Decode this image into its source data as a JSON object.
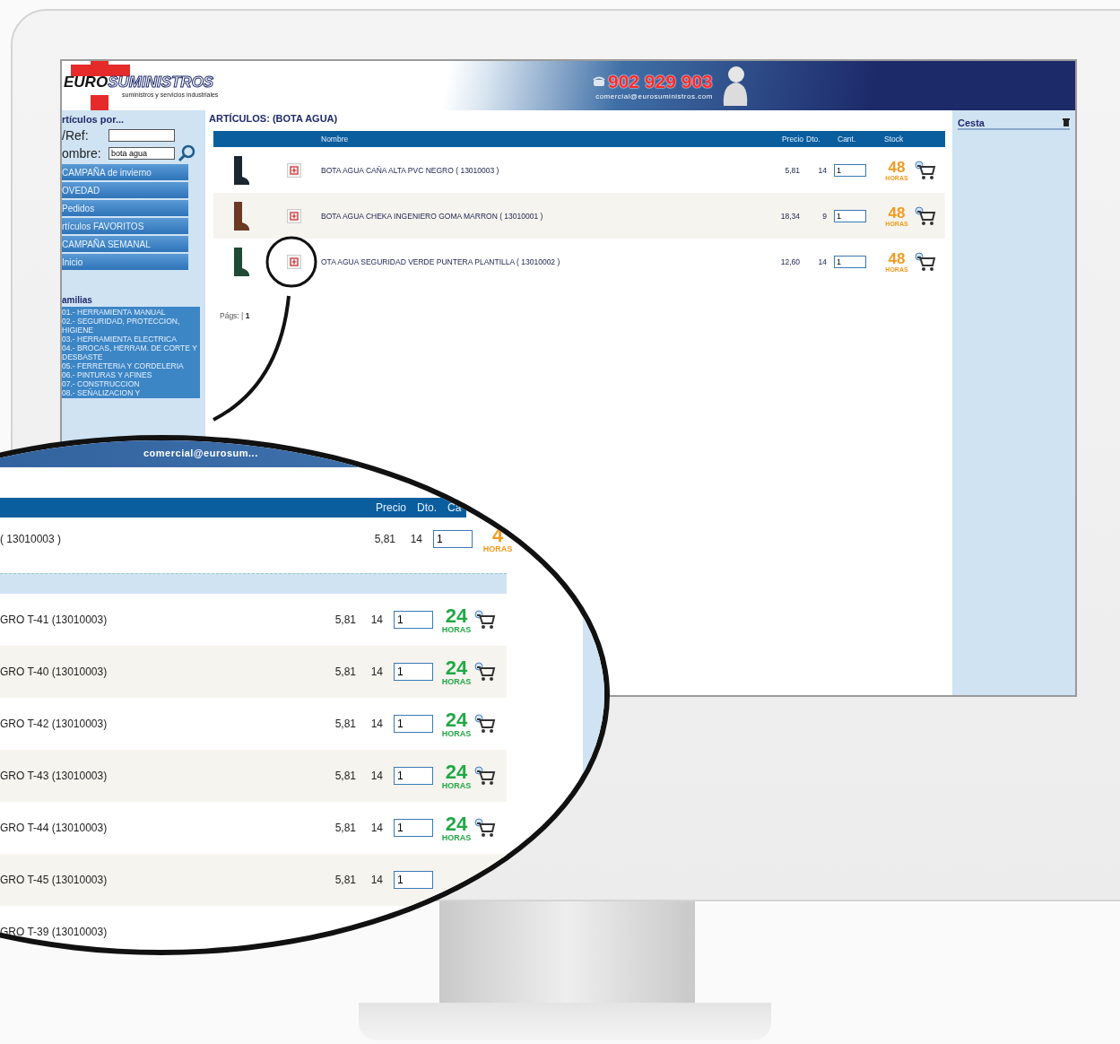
{
  "header": {
    "logo_bold": "EURO",
    "logo_rest": "SUMINISTROS",
    "tagline": "suministros y servicios industriales",
    "phone": "902 929 903",
    "email": "comercial@eurosuministros.com"
  },
  "sidebar": {
    "title": "rtículos por...",
    "ref_label": "/Ref:",
    "name_label": "ombre:",
    "name_value": "bota agua",
    "menu": [
      "CAMPAÑA de invierno",
      "OVEDAD",
      "Pedidos",
      "rtículos FAVORITOS",
      "CAMPAÑA SEMANAL",
      "Inicio"
    ],
    "families_title": "amilias",
    "families": [
      "01.- HERRAMIENTA MANUAL",
      "02.- SEGURIDAD, PROTECCION, HIGIENE",
      "03.- HERRAMIENTA ELECTRICA",
      "04.- BROCAS, HERRAM. DE CORTE Y DESBASTE",
      "05.- FERRETERIA Y CORDELERIA",
      "06.- PINTURAS Y AFINES",
      "07.- CONSTRUCCION",
      "08.- SEÑALIZACION Y"
    ]
  },
  "main": {
    "title": "ARTÍCULOS: (BOTA AGUA)",
    "columns": [
      "Nombre",
      "Precio",
      "Dto.",
      "Cant.",
      "Stock"
    ],
    "rows": [
      {
        "color": "#1a2630",
        "name": "BOTA AGUA CAÑA ALTA PVC NEGRO ( 13010003 )",
        "price": "5,81",
        "discount": "14",
        "qty": "1",
        "stock": {
          "value": "48",
          "unit": "HORAS",
          "color": "#f39a1e"
        }
      },
      {
        "color": "#6b3a22",
        "name": "BOTA AGUA CHEKA INGENIERO GOMA MARRON ( 13010001 )",
        "price": "18,34",
        "discount": "9",
        "qty": "1",
        "stock": {
          "value": "48",
          "unit": "HORAS",
          "color": "#f39a1e"
        }
      },
      {
        "color": "#1f4a35",
        "name": "OTA AGUA SEGURIDAD VERDE PUNTERA PLANTILLA ( 13010002 )",
        "price": "12,60",
        "discount": "14",
        "qty": "1",
        "stock": {
          "value": "48",
          "unit": "HORAS",
          "color": "#f39a1e"
        }
      }
    ],
    "pager_label": "Págs: |",
    "page": "1"
  },
  "basket": {
    "title": "Cesta"
  },
  "magnifier": {
    "email": "comercial@eurosum...",
    "columns": [
      "Precio",
      "Dto.",
      "Ca"
    ],
    "main_row": {
      "name": "( 13010003 )",
      "price": "5,81",
      "discount": "14",
      "qty": "1",
      "stock": {
        "value": "4",
        "unit": "HORAS",
        "color": "#f39a1e"
      }
    },
    "rows": [
      {
        "name": "GRO T-41 (13010003)",
        "price": "5,81",
        "discount": "14",
        "qty": "1",
        "stock": {
          "value": "24",
          "unit": "HORAS",
          "color": "#22a847"
        }
      },
      {
        "name": "GRO T-40 (13010003)",
        "price": "5,81",
        "discount": "14",
        "qty": "1",
        "stock": {
          "value": "24",
          "unit": "HORAS",
          "color": "#22a847"
        }
      },
      {
        "name": "GRO T-42 (13010003)",
        "price": "5,81",
        "discount": "14",
        "qty": "1",
        "stock": {
          "value": "24",
          "unit": "HORAS",
          "color": "#22a847"
        }
      },
      {
        "name": "GRO T-43 (13010003)",
        "price": "5,81",
        "discount": "14",
        "qty": "1",
        "stock": {
          "value": "24",
          "unit": "HORAS",
          "color": "#22a847"
        }
      },
      {
        "name": "GRO T-44 (13010003)",
        "price": "5,81",
        "discount": "14",
        "qty": "1",
        "stock": {
          "value": "24",
          "unit": "HORAS",
          "color": "#22a847"
        }
      },
      {
        "name": "GRO T-45 (13010003)",
        "price": "5,81",
        "discount": "14",
        "qty": "1"
      },
      {
        "name": "GRO T-39 (13010003)"
      }
    ]
  }
}
